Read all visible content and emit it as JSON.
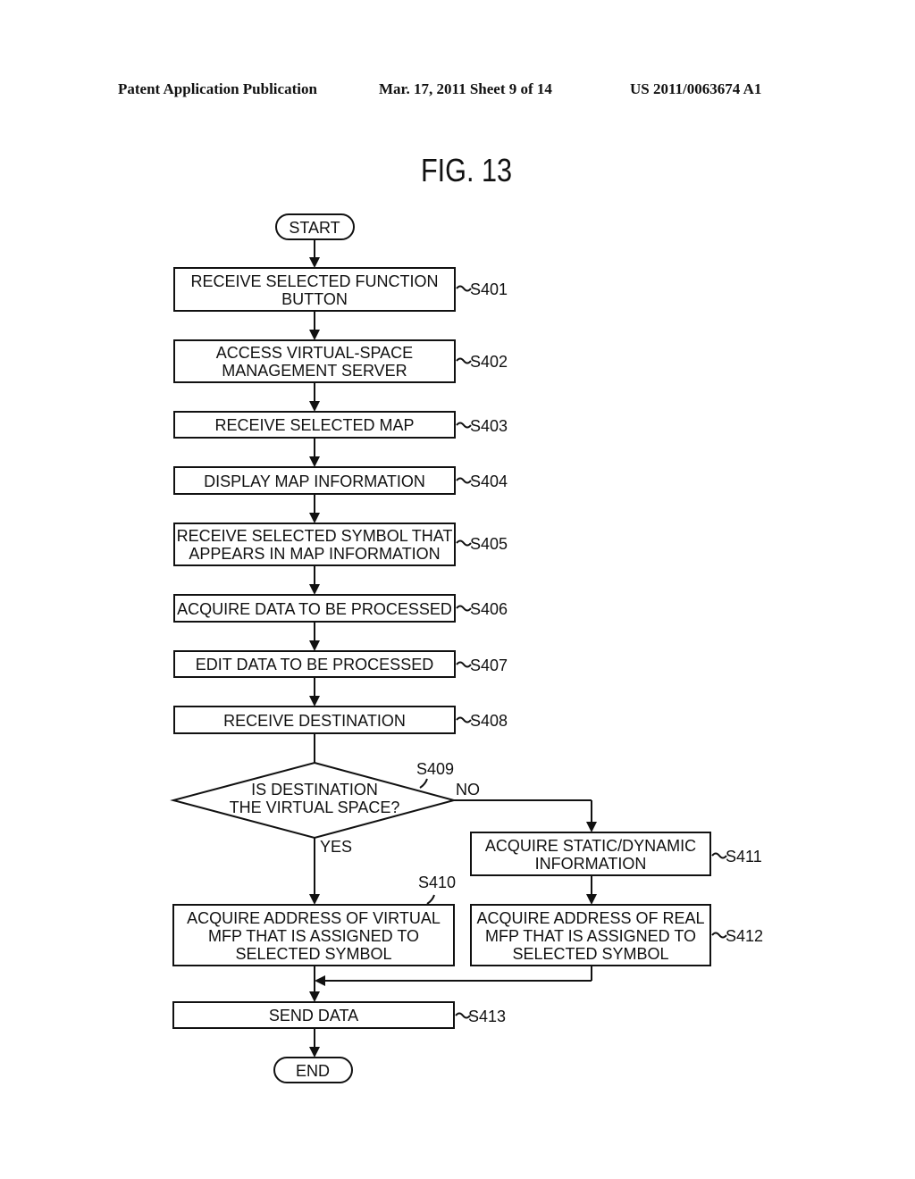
{
  "header": {
    "publication": "Patent Application Publication",
    "date_sheet": "Mar. 17, 2011  Sheet 9 of 14",
    "patent_number": "US 2011/0063674 A1"
  },
  "figure": {
    "title": "FIG. 13"
  },
  "flowchart": {
    "start": "START",
    "end": "END",
    "steps": [
      {
        "id": "S401",
        "lines": [
          "RECEIVE SELECTED FUNCTION",
          "BUTTON"
        ]
      },
      {
        "id": "S402",
        "lines": [
          "ACCESS VIRTUAL-SPACE",
          "MANAGEMENT SERVER"
        ]
      },
      {
        "id": "S403",
        "lines": [
          "RECEIVE SELECTED MAP"
        ]
      },
      {
        "id": "S404",
        "lines": [
          "DISPLAY MAP INFORMATION"
        ]
      },
      {
        "id": "S405",
        "lines": [
          "RECEIVE SELECTED SYMBOL THAT",
          "APPEARS IN MAP INFORMATION"
        ]
      },
      {
        "id": "S406",
        "lines": [
          "ACQUIRE DATA TO BE PROCESSED"
        ]
      },
      {
        "id": "S407",
        "lines": [
          "EDIT DATA TO BE PROCESSED"
        ]
      },
      {
        "id": "S408",
        "lines": [
          "RECEIVE DESTINATION"
        ]
      },
      {
        "id": "S409",
        "lines": [
          "IS DESTINATION",
          "THE VIRTUAL SPACE?"
        ]
      },
      {
        "id": "S410",
        "lines": [
          "ACQUIRE ADDRESS OF VIRTUAL",
          "MFP THAT IS ASSIGNED TO",
          "SELECTED SYMBOL"
        ]
      },
      {
        "id": "S411",
        "lines": [
          "ACQUIRE STATIC/DYNAMIC",
          "INFORMATION"
        ]
      },
      {
        "id": "S412",
        "lines": [
          "ACQUIRE ADDRESS OF REAL",
          "MFP THAT IS ASSIGNED TO",
          "SELECTED SYMBOL"
        ]
      },
      {
        "id": "S413",
        "lines": [
          "SEND DATA"
        ]
      }
    ],
    "branch_yes": "YES",
    "branch_no": "NO"
  }
}
